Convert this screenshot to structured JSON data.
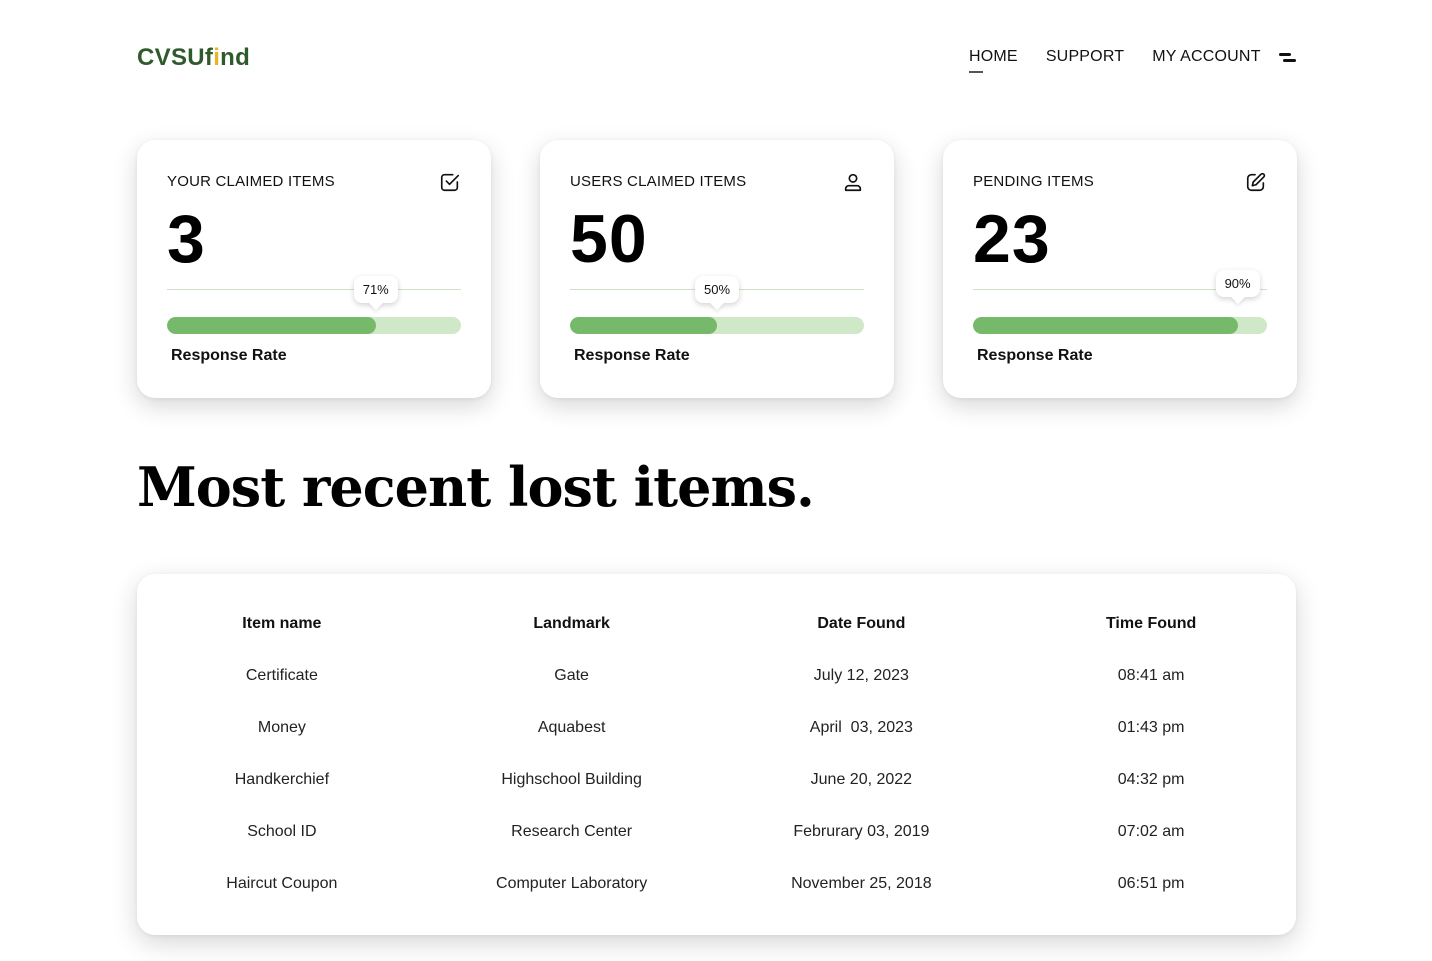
{
  "header": {
    "logo_main": "CVSU",
    "logo_i_prefix": "f",
    "logo_i": "i",
    "logo_suffix": "nd",
    "nav": [
      {
        "label": "HOME",
        "active": true
      },
      {
        "label": "SUPPORT",
        "active": false
      },
      {
        "label": "MY ACCOUNT",
        "active": false
      }
    ],
    "menu_icon": "hamburger-icon"
  },
  "cards": [
    {
      "label": "YOUR CLAIMED ITEMS",
      "icon": "check-square-icon",
      "value": "3",
      "percent_text": "71%",
      "percent": 71,
      "rate_label": "Response Rate"
    },
    {
      "label": "USERS CLAIMED ITEMS",
      "icon": "user-icon",
      "value": "50",
      "percent_text": "50%",
      "percent": 50,
      "rate_label": "Response Rate"
    },
    {
      "label": "PENDING ITEMS",
      "icon": "edit-icon",
      "value": "23",
      "percent_text": "90%",
      "percent": 90,
      "rate_label": "Response Rate"
    }
  ],
  "heading": "Most recent lost items.",
  "table": {
    "headers": [
      "Item name",
      "Landmark",
      "Date Found",
      "Time Found"
    ],
    "rows": [
      [
        "Certificate",
        "Gate",
        "July 12, 2023",
        "08:41 am"
      ],
      [
        "Money",
        "Aquabest",
        "April  03, 2023",
        "01:43 pm"
      ],
      [
        "Handkerchief",
        "Highschool Building",
        "June 20, 2022",
        "04:32 pm"
      ],
      [
        "School ID",
        "Research Center",
        "Februrary 03, 2019",
        "07:02 am"
      ],
      [
        "Haircut Coupon",
        "Computer Laboratory",
        "November 25, 2018",
        "06:51 pm"
      ]
    ]
  },
  "colors": {
    "brand_green": "#2f5a2c",
    "brand_yellow": "#e7b52a",
    "progress_fill": "#77b96b",
    "progress_track": "#cfe8c8"
  }
}
